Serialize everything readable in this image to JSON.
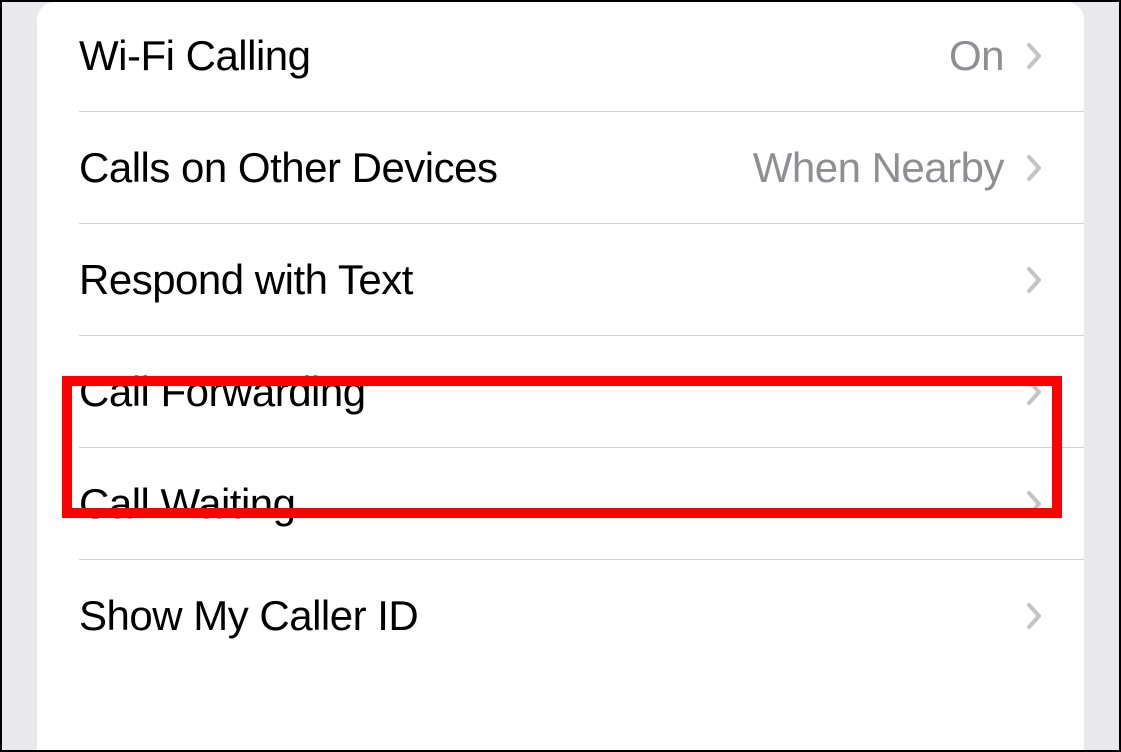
{
  "settings": {
    "items": [
      {
        "label": "Wi-Fi Calling",
        "value": "On"
      },
      {
        "label": "Calls on Other Devices",
        "value": "When Nearby"
      },
      {
        "label": "Respond with Text",
        "value": ""
      },
      {
        "label": "Call Forwarding",
        "value": ""
      },
      {
        "label": "Call Waiting",
        "value": ""
      },
      {
        "label": "Show My Caller ID",
        "value": ""
      }
    ]
  },
  "highlight": {
    "target": "call-forwarding"
  }
}
